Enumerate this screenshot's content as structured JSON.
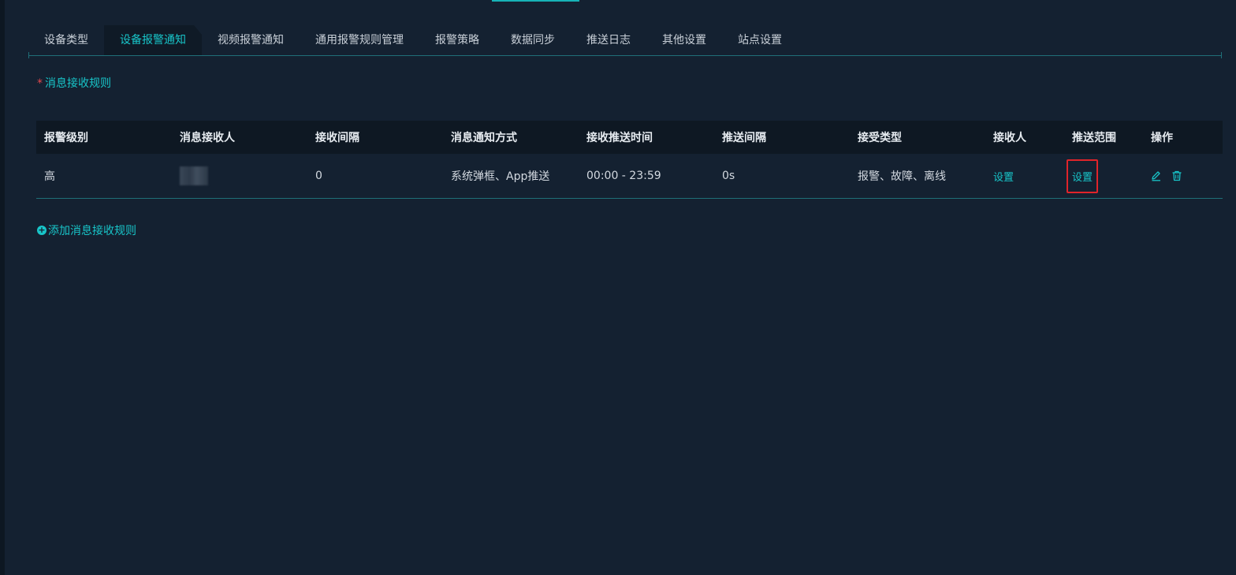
{
  "tabs": [
    {
      "label": "设备类型",
      "active": false
    },
    {
      "label": "设备报警通知",
      "active": true
    },
    {
      "label": "视频报警通知",
      "active": false
    },
    {
      "label": "通用报警规则管理",
      "active": false
    },
    {
      "label": "报警策略",
      "active": false
    },
    {
      "label": "数据同步",
      "active": false
    },
    {
      "label": "推送日志",
      "active": false
    },
    {
      "label": "其他设置",
      "active": false
    },
    {
      "label": "站点设置",
      "active": false
    }
  ],
  "section": {
    "required_mark": "*",
    "title": "消息接收规则"
  },
  "table": {
    "headers": [
      "报警级别",
      "消息接收人",
      "接收间隔",
      "消息通知方式",
      "接收推送时间",
      "推送间隔",
      "接受类型",
      "接收人",
      "推送范围",
      "操作"
    ],
    "rows": [
      {
        "level": "高",
        "receiver": "",
        "interval": "0",
        "notify_method": "系统弹框、App推送",
        "push_time": "00:00 - 23:59",
        "push_interval": "0s",
        "accept_type": "报警、故障、离线",
        "receiver_link": "设置",
        "push_scope_link": "设置"
      }
    ]
  },
  "add_rule": {
    "icon": "plus-circle-icon",
    "label": "添加消息接收规则"
  },
  "colors": {
    "background": "#142131",
    "accent": "#18c5c9",
    "highlight": "#e0242a"
  }
}
